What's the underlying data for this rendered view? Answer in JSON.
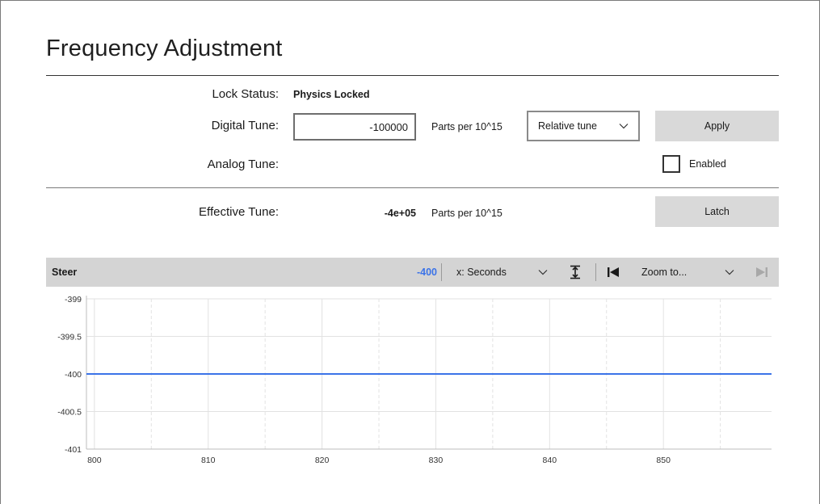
{
  "title": "Frequency Adjustment",
  "lock": {
    "label": "Lock Status:",
    "value": "Physics Locked"
  },
  "digital": {
    "label": "Digital Tune:",
    "value": "-100000",
    "units": "Parts per 10^15",
    "mode": "Relative tune",
    "apply_label": "Apply"
  },
  "analog": {
    "label": "Analog Tune:",
    "enabled_label": "Enabled",
    "enabled": false
  },
  "effective": {
    "label": "Effective Tune:",
    "value": "-4e+05",
    "units": "Parts per 10^15",
    "latch_label": "Latch"
  },
  "toolbar": {
    "name": "Steer",
    "current_value": "-400",
    "x_axis_select": "x: Seconds",
    "zoom_select": "Zoom to...",
    "icons": [
      "autoscale-y-icon",
      "jump-to-start-icon",
      "jump-to-end-icon"
    ]
  },
  "colors": {
    "accent": "#3b73e8",
    "toolbar_bg": "#d4d4d4",
    "button_bg": "#d9d9d9"
  },
  "chart_data": {
    "type": "line",
    "xlabel": "",
    "ylabel": "",
    "xlim": [
      799.3,
      859.5
    ],
    "ylim": [
      -401,
      -399
    ],
    "x_ticks": [
      800,
      810,
      820,
      830,
      840,
      850
    ],
    "y_ticks": [
      -399,
      -399.5,
      -400,
      -400.5,
      -401
    ],
    "y_tick_labels": [
      "-399",
      "-399.5",
      "-400",
      "-400.5",
      "-401"
    ],
    "grid": true,
    "series": [
      {
        "color": "#3b73e8",
        "x": [
          799.3,
          859.5
        ],
        "y": [
          -400,
          -400
        ]
      }
    ]
  }
}
